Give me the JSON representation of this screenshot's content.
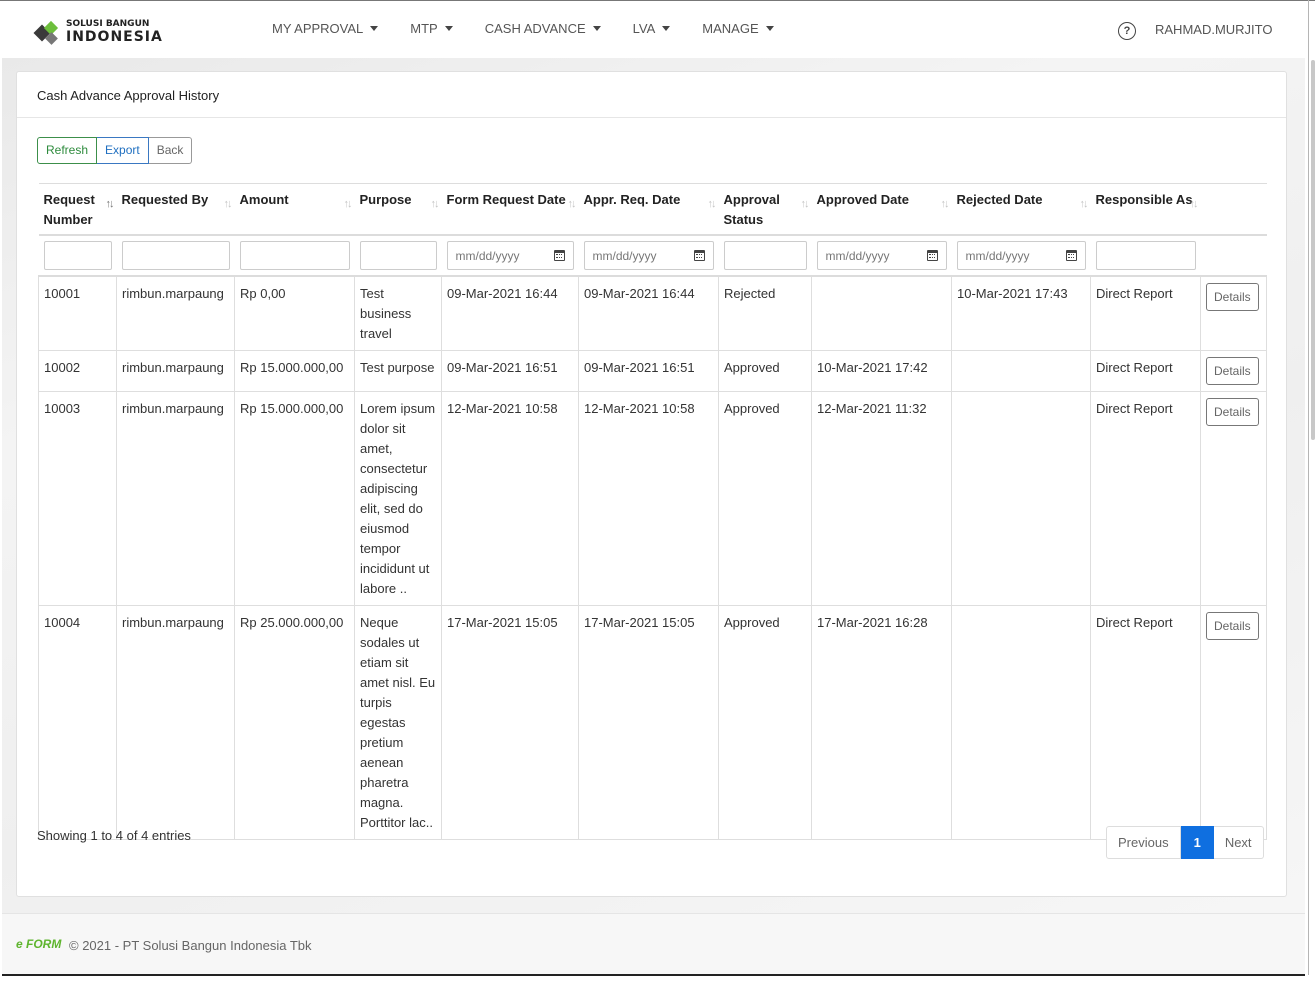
{
  "brand": {
    "line1": "SOLUSI BANGUN",
    "line2": "INDONESIA"
  },
  "nav": {
    "items": [
      {
        "label": "MY APPROVAL"
      },
      {
        "label": "MTP"
      },
      {
        "label": "CASH ADVANCE"
      },
      {
        "label": "LVA"
      },
      {
        "label": "MANAGE"
      }
    ],
    "help": "?",
    "user": "RAHMAD.MURJITO"
  },
  "card": {
    "title": "Cash Advance Approval History"
  },
  "toolbar": {
    "refresh": "Refresh",
    "export": "Export",
    "back": "Back"
  },
  "table": {
    "columns": [
      "Request Number",
      "Requested By",
      "Amount",
      "Purpose",
      "Form Request Date",
      "Appr. Req. Date",
      "Approval Status",
      "Approved Date",
      "Rejected Date",
      "Responsible As",
      ""
    ],
    "date_placeholder": "mm/dd/yyyy",
    "sort_glyph": "↑↓",
    "rows": [
      {
        "number": "10001",
        "by": "rimbun.marpaung",
        "amount": "Rp 0,00",
        "purpose": "Test business travel",
        "form_date": "09-Mar-2021 16:44",
        "appr_req_date": "09-Mar-2021 16:44",
        "status": "Rejected",
        "approved_date": "",
        "rejected_date": "10-Mar-2021 17:43",
        "responsible": "Direct Report",
        "action": "Details"
      },
      {
        "number": "10002",
        "by": "rimbun.marpaung",
        "amount": "Rp 15.000.000,00",
        "purpose": "Test purpose",
        "form_date": "09-Mar-2021 16:51",
        "appr_req_date": "09-Mar-2021 16:51",
        "status": "Approved",
        "approved_date": "10-Mar-2021 17:42",
        "rejected_date": "",
        "responsible": "Direct Report",
        "action": "Details"
      },
      {
        "number": "10003",
        "by": "rimbun.marpaung",
        "amount": "Rp 15.000.000,00",
        "purpose": "Lorem ipsum dolor sit amet, consectetur adipiscing elit, sed do eiusmod tempor incididunt ut labore ..",
        "form_date": "12-Mar-2021 10:58",
        "appr_req_date": "12-Mar-2021 10:58",
        "status": "Approved",
        "approved_date": "12-Mar-2021 11:32",
        "rejected_date": "",
        "responsible": "Direct Report",
        "action": "Details"
      },
      {
        "number": "10004",
        "by": "rimbun.marpaung",
        "amount": "Rp 25.000.000,00",
        "purpose": "Neque sodales ut etiam sit amet nisl. Eu turpis egestas pretium aenean pharetra magna. Porttitor lac..",
        "form_date": "17-Mar-2021 15:05",
        "appr_req_date": "17-Mar-2021 15:05",
        "status": "Approved",
        "approved_date": "17-Mar-2021 16:28",
        "rejected_date": "",
        "responsible": "Direct Report",
        "action": "Details"
      }
    ]
  },
  "info": "Showing 1 to 4 of 4 entries",
  "pagination": {
    "previous": "Previous",
    "current": "1",
    "next": "Next"
  },
  "footer": {
    "logo": "e FORM",
    "text": "© 2021 - PT Solusi Bangun Indonesia Tbk"
  },
  "colors": {
    "accent": "#0f6fe0",
    "refresh": "#2e8b3d",
    "export": "#1f6fc0",
    "brand_green": "#6dbf3c"
  }
}
